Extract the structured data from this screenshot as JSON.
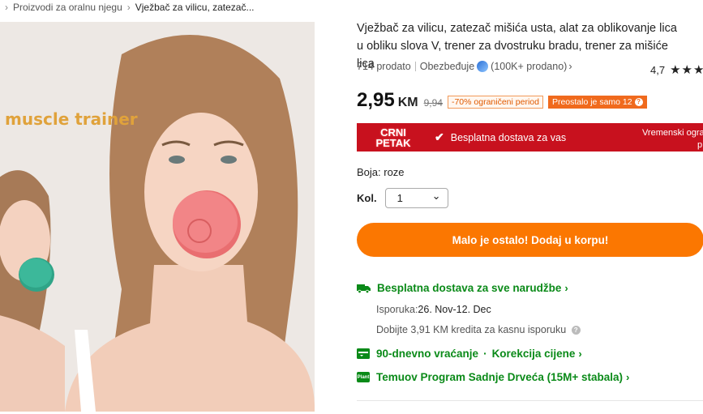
{
  "breadcrumb": {
    "items": [
      "Proizvodi za oralnu njegu",
      "Vježbač za vilicu, zatezač..."
    ],
    "separator": "›"
  },
  "image": {
    "overlay_text": "muscle trainer",
    "colors": {
      "device_pink": "#f07d7d",
      "device_green": "#3cb89a",
      "background": "#ede8e4"
    }
  },
  "product": {
    "title": "Vježbač za vilicu, zatezač mišića usta, alat za oblikovanje lica u obliku slova V, trener za dvostruku bradu, trener za mišiće lica",
    "sold": "714 prodato",
    "provider": "Obezbeđuje",
    "provider_count": "(100K+ prodano)",
    "provider_chevron": "›",
    "rating": "4,7",
    "stars": "★★★",
    "price_main": "2,95",
    "price_currency": "KM",
    "price_old": "9,94",
    "discount_badge": "-70% ograničeni period",
    "stock_badge": "Preostalo je samo 12",
    "stock_badge_icon": "?"
  },
  "promo": {
    "line1": "CRNI",
    "line2": "PETAK",
    "check": "✔",
    "free_shipping": "Besplatna dostava za vas",
    "limited_line1": "Vremenski ogra",
    "limited_line2": "p",
    "colors": {
      "background": "#c8111e"
    }
  },
  "options": {
    "color_label": "Boja: roze",
    "qty_label": "Kol.",
    "qty_value": "1",
    "qty_chevron": "⌄"
  },
  "cta": {
    "label": "Malo je ostalo! Dodaj u korpu!",
    "color": "#fb7701"
  },
  "shipping": {
    "free_all": "Besplatna dostava za sve narudžbe",
    "delivery_label": "Isporuka:",
    "delivery_dates": "26. Nov-12. Dec",
    "credit": "Dobijte 3,91 KM kredita za kasnu isporuku",
    "credit_icon": "?",
    "returns": "90-dnevno vraćanje",
    "bullet": "·",
    "price_adjust": "Korekcija cijene",
    "trees": "Temuov Program Sadnje Drveća (15M+ stabala)",
    "plant_badge": "Plant",
    "chevron": "›",
    "color": "#0a8a18"
  }
}
